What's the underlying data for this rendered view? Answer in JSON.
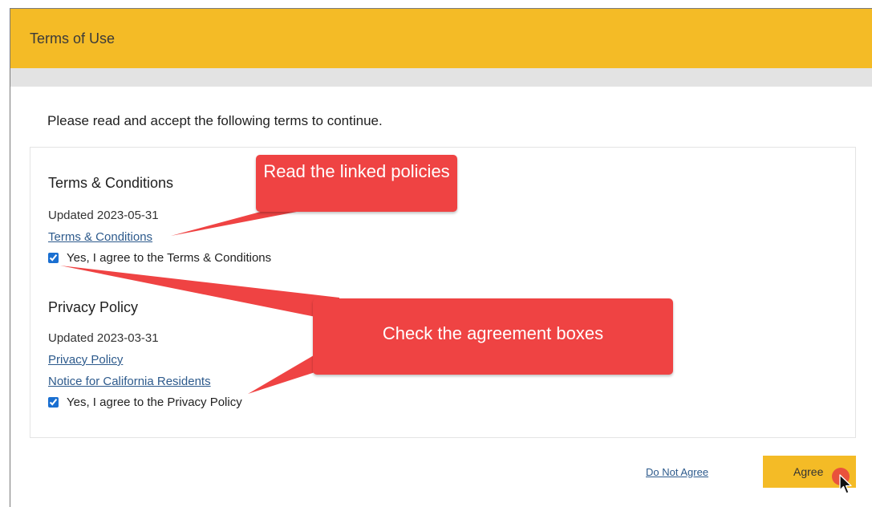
{
  "dialog": {
    "title": "Terms of Use",
    "intro": "Please read and accept the following terms to continue."
  },
  "terms": {
    "title": "Terms & Conditions",
    "updated": "Updated 2023-05-31",
    "link": "Terms & Conditions",
    "agree_label": "Yes, I agree to the Terms & Conditions",
    "agree_checked": true
  },
  "privacy": {
    "title": "Privacy Policy",
    "updated": "Updated 2023-03-31",
    "link_privacy": "Privacy Policy",
    "link_california": "Notice for California Residents",
    "agree_label": "Yes, I agree to the Privacy Policy",
    "agree_checked": true
  },
  "footer": {
    "do_not_agree": "Do Not Agree",
    "agree": "Agree"
  },
  "annotations": {
    "callout_links": "Read the linked policies",
    "callout_checkboxes": "Check the agreement boxes"
  },
  "colors": {
    "header": "#f4bb26",
    "callout": "#ef4343",
    "link": "#2d5a8c",
    "checkbox": "#1a6fd1"
  }
}
